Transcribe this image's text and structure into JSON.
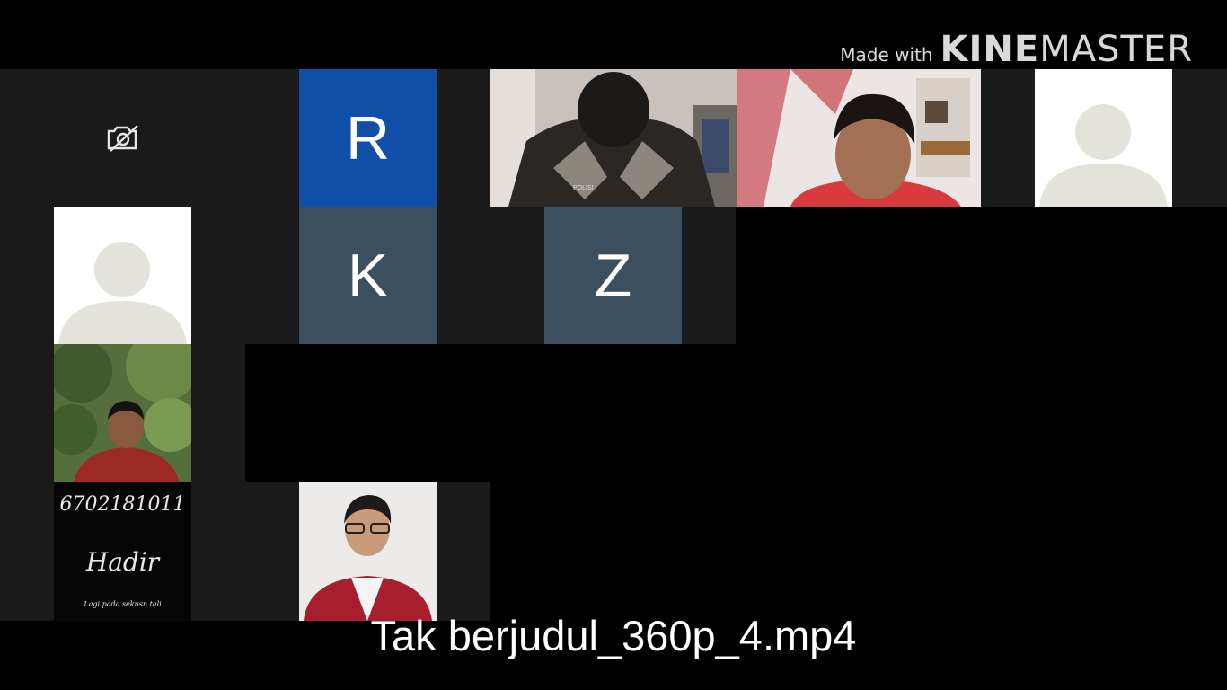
{
  "watermark": {
    "prefix": "Made with",
    "brand_bold": "KINE",
    "brand_rest": "MASTER"
  },
  "participants": {
    "r_initial": "R",
    "k_initial": "K",
    "z_initial": "Z",
    "r_color": "#0f4fa8",
    "kz_color": "#3b4f5e"
  },
  "note_tile": {
    "number": "6702181011",
    "status": "Hadir",
    "small_text": "Lagi pada sekusn tali"
  },
  "video_shirt_label": "POLISI",
  "caption": "Tak berjudul_360p_4.mp4",
  "icons": {
    "camera_off": "camera-off-icon",
    "avatar": "person-avatar-icon"
  }
}
